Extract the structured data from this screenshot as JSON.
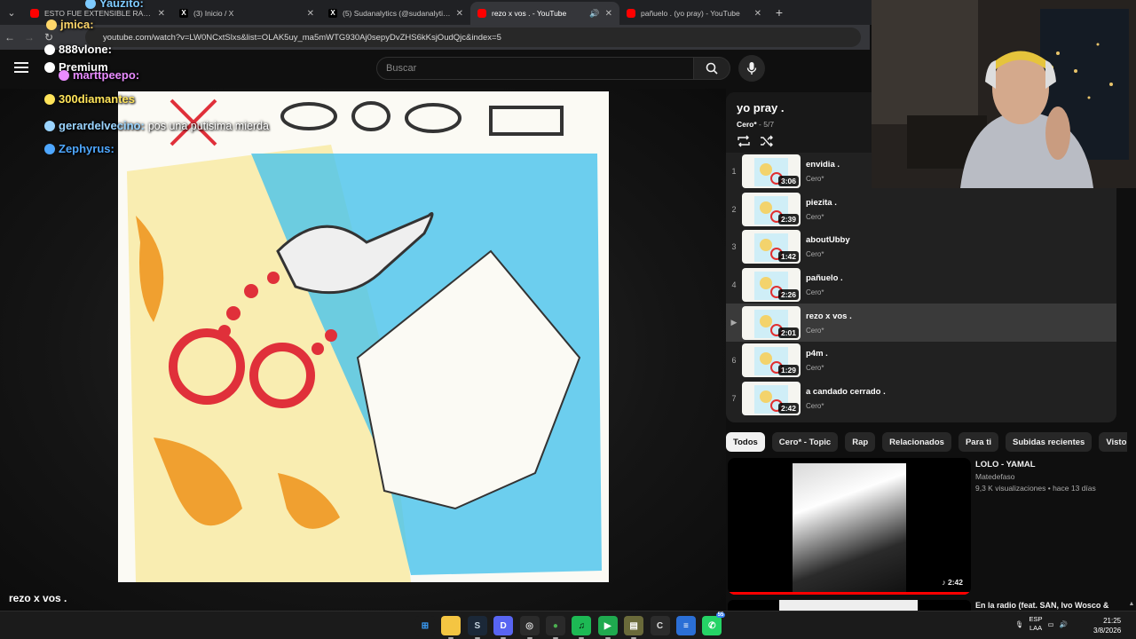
{
  "browser": {
    "tabs": [
      {
        "label": "ESTO FUE EXTENSIBLE RAGEY...",
        "favicon": "youtube-icon",
        "active": false
      },
      {
        "label": "(3) Inicio / X",
        "favicon": "x-icon",
        "active": false
      },
      {
        "label": "(5) Sudanalytics (@sudanalytics...",
        "favicon": "x-icon",
        "active": false
      },
      {
        "label": "rezo x vos . - YouTube",
        "favicon": "youtube-icon",
        "active": true,
        "sound": true
      },
      {
        "label": "pañuelo . (yo pray) - YouTube",
        "favicon": "youtube-icon",
        "active": false
      }
    ],
    "url": "youtube.com/watch?v=LW0NCxtSlxs&list=OLAK5uy_ma5mWTG930Aj0sepyDvZHS6kKsjOudQjc&index=5"
  },
  "youtube": {
    "search_placeholder": "Buscar",
    "video_title": "rezo x vos ."
  },
  "chat": [
    {
      "user": "Yauzito:",
      "msg": "",
      "color": "#7ecbff"
    },
    {
      "user": "jmica:",
      "msg": "",
      "color": "#ffd76a"
    },
    {
      "user": "888vlone:",
      "msg": "",
      "color": "#ffffff"
    },
    {
      "user": "Premium",
      "msg": "",
      "color": "#ffffff"
    },
    {
      "user": "marttpeepo:",
      "msg": "",
      "color": "#e98cff"
    },
    {
      "user": "300diamantes",
      "msg": "",
      "color": "#ffe45a"
    },
    {
      "user": "gerardelvecino:",
      "msg": "pos una putisima mierda",
      "color": "#9ad4ff"
    },
    {
      "user": "Zephyrus:",
      "msg": "",
      "color": "#4ea7ff"
    }
  ],
  "playlist": {
    "title": "yo pray .",
    "artist": "Cero*",
    "position": " - 5/7",
    "items": [
      {
        "index": "1",
        "title": "envidia .",
        "artist": "Cero*",
        "duration": "3:06",
        "current": false
      },
      {
        "index": "2",
        "title": "piezita .",
        "artist": "Cero*",
        "duration": "2:39",
        "current": false
      },
      {
        "index": "3",
        "title": "aboutUbby",
        "artist": "Cero*",
        "duration": "1:42",
        "current": false
      },
      {
        "index": "4",
        "title": "pañuelo .",
        "artist": "Cero*",
        "duration": "2:26",
        "current": false
      },
      {
        "index": "▶",
        "title": "rezo x vos .",
        "artist": "Cero*",
        "duration": "2:01",
        "current": true
      },
      {
        "index": "6",
        "title": "p4m .",
        "artist": "Cero*",
        "duration": "1:29",
        "current": false
      },
      {
        "index": "7",
        "title": "a candado cerrado .",
        "artist": "Cero*",
        "duration": "2:42",
        "current": false
      }
    ]
  },
  "chips": [
    "Todos",
    "Cero* - Topic",
    "Rap",
    "Relacionados",
    "Para ti",
    "Subidas recientes",
    "Visto"
  ],
  "recommendations": [
    {
      "title": "LOLO - YAMAL",
      "channel": "Matedefaso",
      "stats": "9,3 K visualizaciones • hace 13 días",
      "duration": "♪ 2:42",
      "watched_fraction": 1.0
    },
    {
      "title": "En la radio (feat. SAN, Ivo Wosco &"
    }
  ],
  "taskbar": {
    "apps": [
      {
        "name": "windows-start-icon",
        "glyph": "⊞",
        "bg": "#1b1b1b",
        "fg": "#3aa0ff"
      },
      {
        "name": "file-explorer-icon",
        "glyph": "",
        "bg": "#f4c542",
        "fg": "#000"
      },
      {
        "name": "steam-icon",
        "glyph": "S",
        "bg": "#1b2838",
        "fg": "#c7d5e0"
      },
      {
        "name": "discord-icon",
        "glyph": "D",
        "bg": "#5865f2",
        "fg": "#fff"
      },
      {
        "name": "obs-icon",
        "glyph": "◎",
        "bg": "#2b2b2b",
        "fg": "#ddd"
      },
      {
        "name": "chrome-icon",
        "glyph": "●",
        "bg": "#2a2a2a",
        "fg": "#4caf50"
      },
      {
        "name": "spotify-icon",
        "glyph": "♫",
        "bg": "#1db954",
        "fg": "#000"
      },
      {
        "name": "app-green-icon",
        "glyph": "▶",
        "bg": "#1faa4f",
        "fg": "#fff"
      },
      {
        "name": "app-card-icon",
        "glyph": "▤",
        "bg": "#6a6a3a",
        "fg": "#fff"
      },
      {
        "name": "ccleaner-icon",
        "glyph": "C",
        "bg": "#2c2c2c",
        "fg": "#ddd"
      },
      {
        "name": "notepad-icon",
        "glyph": "≡",
        "bg": "#2b6fd6",
        "fg": "#fff"
      },
      {
        "name": "whatsapp-icon",
        "glyph": "✆",
        "bg": "#25d366",
        "fg": "#fff",
        "badge": "55"
      }
    ],
    "lang": "ESP",
    "layout": "LAA",
    "time": "21:25",
    "date": "3/8/2026"
  },
  "colors": {
    "accent_red": "#ff0000",
    "yt_bg": "#0f0f0f",
    "panel": "#212121"
  }
}
